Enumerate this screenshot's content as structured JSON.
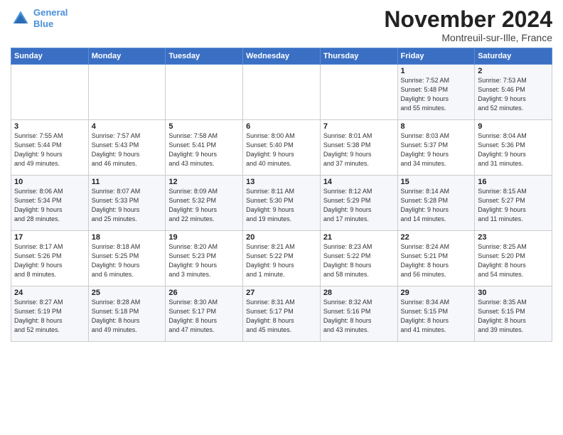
{
  "header": {
    "logo_line1": "General",
    "logo_line2": "Blue",
    "month_title": "November 2024",
    "subtitle": "Montreuil-sur-Ille, France"
  },
  "days_of_week": [
    "Sunday",
    "Monday",
    "Tuesday",
    "Wednesday",
    "Thursday",
    "Friday",
    "Saturday"
  ],
  "weeks": [
    [
      {
        "day": "",
        "info": ""
      },
      {
        "day": "",
        "info": ""
      },
      {
        "day": "",
        "info": ""
      },
      {
        "day": "",
        "info": ""
      },
      {
        "day": "",
        "info": ""
      },
      {
        "day": "1",
        "info": "Sunrise: 7:52 AM\nSunset: 5:48 PM\nDaylight: 9 hours\nand 55 minutes."
      },
      {
        "day": "2",
        "info": "Sunrise: 7:53 AM\nSunset: 5:46 PM\nDaylight: 9 hours\nand 52 minutes."
      }
    ],
    [
      {
        "day": "3",
        "info": "Sunrise: 7:55 AM\nSunset: 5:44 PM\nDaylight: 9 hours\nand 49 minutes."
      },
      {
        "day": "4",
        "info": "Sunrise: 7:57 AM\nSunset: 5:43 PM\nDaylight: 9 hours\nand 46 minutes."
      },
      {
        "day": "5",
        "info": "Sunrise: 7:58 AM\nSunset: 5:41 PM\nDaylight: 9 hours\nand 43 minutes."
      },
      {
        "day": "6",
        "info": "Sunrise: 8:00 AM\nSunset: 5:40 PM\nDaylight: 9 hours\nand 40 minutes."
      },
      {
        "day": "7",
        "info": "Sunrise: 8:01 AM\nSunset: 5:38 PM\nDaylight: 9 hours\nand 37 minutes."
      },
      {
        "day": "8",
        "info": "Sunrise: 8:03 AM\nSunset: 5:37 PM\nDaylight: 9 hours\nand 34 minutes."
      },
      {
        "day": "9",
        "info": "Sunrise: 8:04 AM\nSunset: 5:36 PM\nDaylight: 9 hours\nand 31 minutes."
      }
    ],
    [
      {
        "day": "10",
        "info": "Sunrise: 8:06 AM\nSunset: 5:34 PM\nDaylight: 9 hours\nand 28 minutes."
      },
      {
        "day": "11",
        "info": "Sunrise: 8:07 AM\nSunset: 5:33 PM\nDaylight: 9 hours\nand 25 minutes."
      },
      {
        "day": "12",
        "info": "Sunrise: 8:09 AM\nSunset: 5:32 PM\nDaylight: 9 hours\nand 22 minutes."
      },
      {
        "day": "13",
        "info": "Sunrise: 8:11 AM\nSunset: 5:30 PM\nDaylight: 9 hours\nand 19 minutes."
      },
      {
        "day": "14",
        "info": "Sunrise: 8:12 AM\nSunset: 5:29 PM\nDaylight: 9 hours\nand 17 minutes."
      },
      {
        "day": "15",
        "info": "Sunrise: 8:14 AM\nSunset: 5:28 PM\nDaylight: 9 hours\nand 14 minutes."
      },
      {
        "day": "16",
        "info": "Sunrise: 8:15 AM\nSunset: 5:27 PM\nDaylight: 9 hours\nand 11 minutes."
      }
    ],
    [
      {
        "day": "17",
        "info": "Sunrise: 8:17 AM\nSunset: 5:26 PM\nDaylight: 9 hours\nand 8 minutes."
      },
      {
        "day": "18",
        "info": "Sunrise: 8:18 AM\nSunset: 5:25 PM\nDaylight: 9 hours\nand 6 minutes."
      },
      {
        "day": "19",
        "info": "Sunrise: 8:20 AM\nSunset: 5:23 PM\nDaylight: 9 hours\nand 3 minutes."
      },
      {
        "day": "20",
        "info": "Sunrise: 8:21 AM\nSunset: 5:22 PM\nDaylight: 9 hours\nand 1 minute."
      },
      {
        "day": "21",
        "info": "Sunrise: 8:23 AM\nSunset: 5:22 PM\nDaylight: 8 hours\nand 58 minutes."
      },
      {
        "day": "22",
        "info": "Sunrise: 8:24 AM\nSunset: 5:21 PM\nDaylight: 8 hours\nand 56 minutes."
      },
      {
        "day": "23",
        "info": "Sunrise: 8:25 AM\nSunset: 5:20 PM\nDaylight: 8 hours\nand 54 minutes."
      }
    ],
    [
      {
        "day": "24",
        "info": "Sunrise: 8:27 AM\nSunset: 5:19 PM\nDaylight: 8 hours\nand 52 minutes."
      },
      {
        "day": "25",
        "info": "Sunrise: 8:28 AM\nSunset: 5:18 PM\nDaylight: 8 hours\nand 49 minutes."
      },
      {
        "day": "26",
        "info": "Sunrise: 8:30 AM\nSunset: 5:17 PM\nDaylight: 8 hours\nand 47 minutes."
      },
      {
        "day": "27",
        "info": "Sunrise: 8:31 AM\nSunset: 5:17 PM\nDaylight: 8 hours\nand 45 minutes."
      },
      {
        "day": "28",
        "info": "Sunrise: 8:32 AM\nSunset: 5:16 PM\nDaylight: 8 hours\nand 43 minutes."
      },
      {
        "day": "29",
        "info": "Sunrise: 8:34 AM\nSunset: 5:15 PM\nDaylight: 8 hours\nand 41 minutes."
      },
      {
        "day": "30",
        "info": "Sunrise: 8:35 AM\nSunset: 5:15 PM\nDaylight: 8 hours\nand 39 minutes."
      }
    ]
  ]
}
